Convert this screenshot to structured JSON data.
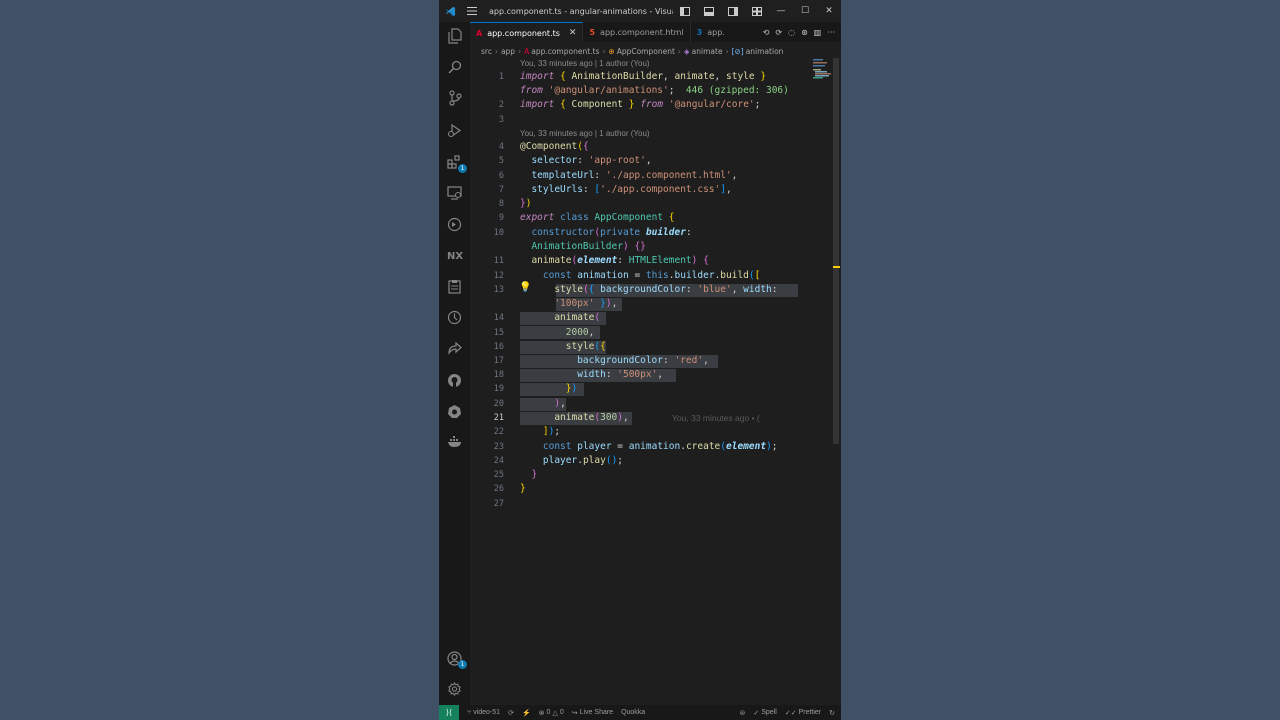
{
  "window": {
    "title": "app.component.ts - angular-animations - Visual Stu..."
  },
  "tabs": [
    {
      "label": "app.component.ts",
      "badge": "A",
      "badge_color": "#dd0031"
    },
    {
      "label": "app.component.html",
      "badge": "5",
      "badge_color": "#e44d26"
    },
    {
      "label": "app.",
      "badge": "3",
      "badge_color": "#1572b6"
    }
  ],
  "breadcrumb": [
    "src",
    "app",
    "app.component.ts",
    "AppComponent",
    "animate",
    "animation"
  ],
  "codelens": {
    "first": "You, 33 minutes ago | 1 author (You)",
    "second": "You, 33 minutes ago | 1 author (You)"
  },
  "import_size_hint": "446 (gzipped: 306)",
  "blame_inline": "You, 33 minutes ago • (",
  "line_numbers": [
    "1",
    "2",
    "3",
    "4",
    "5",
    "6",
    "7",
    "8",
    "9",
    "10",
    "11",
    "12",
    "13",
    "14",
    "15",
    "16",
    "17",
    "18",
    "19",
    "20",
    "21",
    "22",
    "23",
    "24",
    "25",
    "26",
    "27"
  ],
  "status": {
    "branch": "video-51",
    "errors": "0",
    "warnings": "0",
    "live_share": "Live Share",
    "quokka": "Quokka",
    "spell": "Spell",
    "prettier": "Prettier"
  },
  "activity_badges": {
    "extensions": "1",
    "accounts": "1"
  },
  "colors": {
    "accent": "#0078d4",
    "remote": "#16825d",
    "background": "#3f5165"
  }
}
